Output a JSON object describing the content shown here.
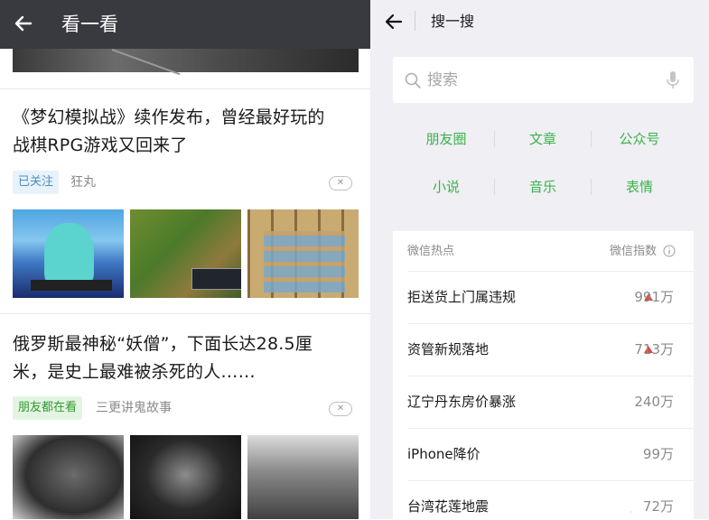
{
  "left": {
    "title": "看一看",
    "articles": [
      {
        "title_line1": "《梦幻模拟战》续作发布，曾经最好玩的",
        "title_line2": "战棋RPG游戏又回来了",
        "tag": "已关注",
        "source": "狂丸",
        "thumb_caption_1": "",
        "close_symbol": "✕"
      },
      {
        "title_line1": "俄罗斯最神秘“妖僧”，下面长达28.5厘",
        "title_line2": "米，是史上最难被杀死的人……",
        "tag": "朋友都在看",
        "source": "三更讲鬼故事",
        "close_symbol": "✕"
      }
    ]
  },
  "right": {
    "title": "搜一搜",
    "search_placeholder": "搜索",
    "categories": [
      "朋友圈",
      "文章",
      "公众号",
      "小说",
      "音乐",
      "表情"
    ],
    "hot": {
      "header_left": "微信热点",
      "header_right": "微信指数",
      "items": [
        {
          "name": "拒送货上门属违规",
          "value": "991万",
          "rising": true
        },
        {
          "name": "资管新规落地",
          "value": "713万",
          "rising": true
        },
        {
          "name": "辽宁丹东房价暴涨",
          "value": "240万",
          "rising": false
        },
        {
          "name": "iPhone降价",
          "value": "99万",
          "rising": false
        },
        {
          "name": "台湾花莲地震",
          "value": "72万",
          "rising": false
        }
      ]
    }
  },
  "watermark": "·",
  "colors": {
    "left_topbar": "#393a3f",
    "green": "#3bb34a",
    "rise_red": "#e64340",
    "right_bg": "#efeff4"
  }
}
